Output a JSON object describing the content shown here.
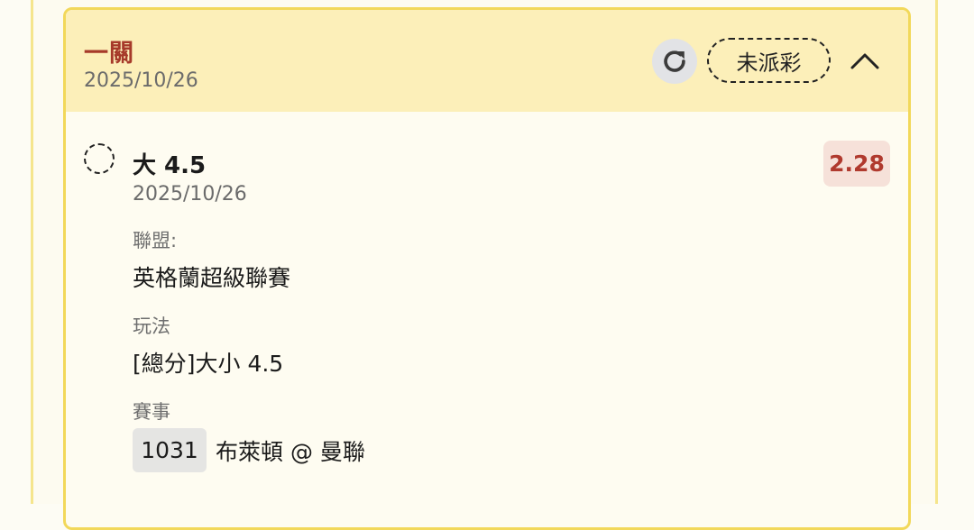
{
  "bet": {
    "type_label": "一關",
    "date": "2025/10/26",
    "status": "未派彩",
    "icons": {
      "refresh": "refresh-icon",
      "collapse": "chevron-up-icon",
      "radio": "radio-unchecked-icon"
    }
  },
  "selection": {
    "name": "大 4.5",
    "date": "2025/10/26",
    "odds": "2.28",
    "league_label": "聯盟:",
    "league_value": "英格蘭超級聯賽",
    "play_label": "玩法",
    "play_value": "[總分]大小 4.5",
    "match_label": "賽事",
    "match_id": "1031",
    "match_teams": "布萊頓 @ 曼聯"
  },
  "colors": {
    "accent_red": "#a63a2a",
    "header_bg": "#fcefb9",
    "card_border": "#f2d85a",
    "odds_bg": "#f6e1d9"
  }
}
